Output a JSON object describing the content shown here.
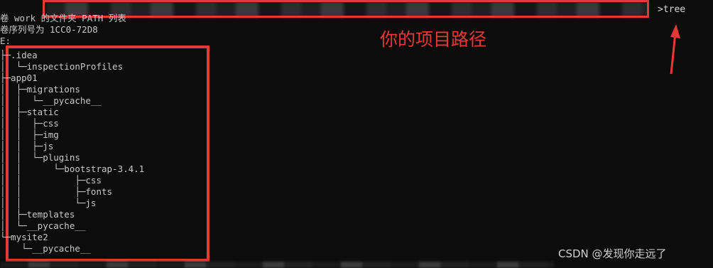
{
  "terminal": {
    "header_lines": [
      "卷 work 的文件夹 PATH 列表",
      "卷序列号为 1CC0-72D8",
      "E:"
    ],
    "command": ">tree",
    "tree_lines": [
      "├─.idea",
      "│  └─inspectionProfiles",
      "├─app01",
      "│  ├─migrations",
      "│  │  └─__pycache__",
      "│  ├─static",
      "│  │  ├─css",
      "│  │  ├─img",
      "│  │  ├─js",
      "│  │  └─plugins",
      "│  │      └─bootstrap-3.4.1",
      "│  │          ├─css",
      "│  │          ├─fonts",
      "│  │          └─js",
      "│  ├─templates",
      "│  └─__pycache__",
      "└─mysite2",
      "    └─__pycache__"
    ]
  },
  "annotation": {
    "label": "你的项目路径"
  },
  "watermark": {
    "text": "CSDN @发现你走远了"
  },
  "colors": {
    "accent": "#e53935",
    "background": "#0c0c0c",
    "text": "#cccccc"
  }
}
